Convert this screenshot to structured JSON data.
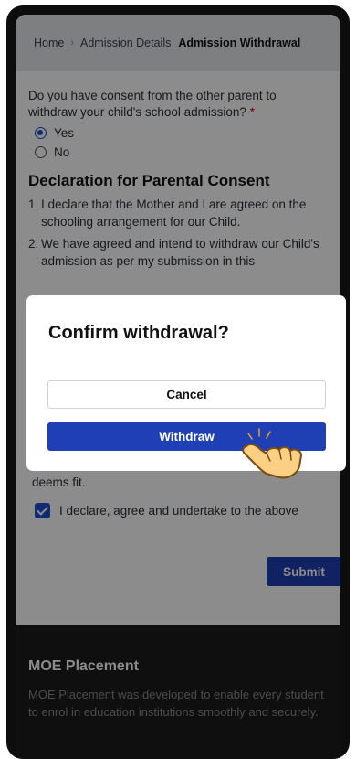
{
  "breadcrumb": {
    "home": "Home",
    "separator": "›",
    "admission_details": "Admission Details",
    "current": "Admission Withdrawal"
  },
  "form": {
    "question": "Do you have consent from the other parent to withdraw your child's school admission?",
    "required_mark": "*",
    "options": [
      {
        "label": "Yes",
        "selected": true
      },
      {
        "label": "No",
        "selected": false
      }
    ],
    "declaration_title": "Declaration for Parental Consent",
    "declarations": [
      {
        "num": "1.",
        "text": "I declare that the Mother and I are agreed on the schooling arrangement for our Child."
      },
      {
        "num": "2.",
        "text": "We have agreed and intend to withdraw our Child's admission as per my submission in this"
      }
    ],
    "deems_text": "deems fit.",
    "agree_label": "I declare, agree and undertake to the above",
    "agree_checked": true,
    "submit_label": "Submit"
  },
  "footer": {
    "title": "MOE Placement",
    "text": "MOE Placement was developed to enable every student to enrol in education institutions smoothly and securely."
  },
  "dialog": {
    "title": "Confirm withdrawal?",
    "cancel_label": "Cancel",
    "withdraw_label": "Withdraw"
  },
  "colors": {
    "primary": "#1f3fb4",
    "radio_checkbox": "#1f4fd1",
    "footer_bg": "#1c1c1c",
    "overlay": "rgba(0,0,0,0.45)"
  },
  "icons": {
    "pointer": "hand-pointer-icon",
    "check": "checkmark-icon"
  }
}
